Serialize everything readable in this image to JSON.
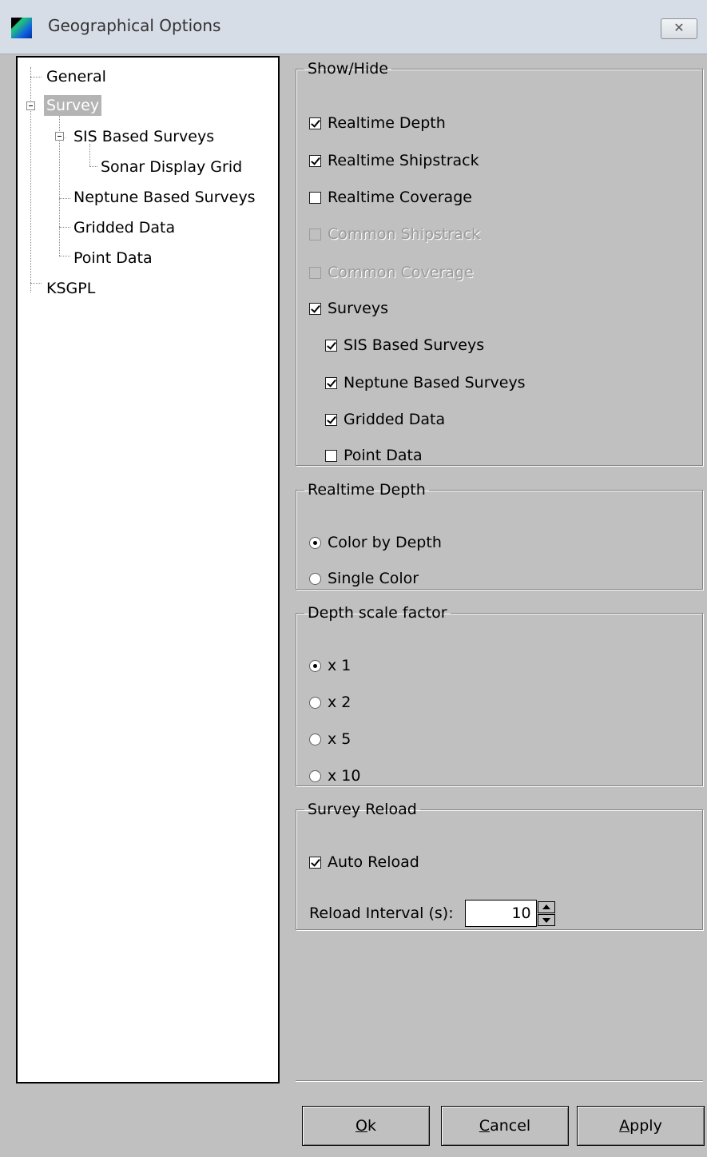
{
  "window": {
    "title": "Geographical Options",
    "close_glyph": "✕"
  },
  "tree": {
    "items": [
      {
        "label": "General"
      },
      {
        "label": "Survey",
        "selected": true
      },
      {
        "label": "SIS Based Surveys"
      },
      {
        "label": "Sonar Display Grid"
      },
      {
        "label": "Neptune Based Surveys"
      },
      {
        "label": "Gridded Data"
      },
      {
        "label": "Point Data"
      },
      {
        "label": "KSGPL"
      }
    ]
  },
  "show_hide": {
    "legend": "Show/Hide",
    "options": [
      {
        "label": "Realtime Depth",
        "checked": true,
        "enabled": true
      },
      {
        "label": "Realtime Shipstrack",
        "checked": true,
        "enabled": true
      },
      {
        "label": "Realtime Coverage",
        "checked": false,
        "enabled": true
      },
      {
        "label": "Common Shipstrack",
        "checked": false,
        "enabled": false
      },
      {
        "label": "Common Coverage",
        "checked": false,
        "enabled": false
      },
      {
        "label": "Surveys",
        "checked": true,
        "enabled": true
      },
      {
        "label": "SIS Based Surveys",
        "checked": true,
        "enabled": true
      },
      {
        "label": "Neptune Based Surveys",
        "checked": true,
        "enabled": true
      },
      {
        "label": "Gridded Data",
        "checked": true,
        "enabled": true
      },
      {
        "label": "Point Data",
        "checked": false,
        "enabled": true
      }
    ]
  },
  "realtime_depth": {
    "legend": "Realtime Depth",
    "options": [
      {
        "label": "Color by Depth",
        "selected": true
      },
      {
        "label": "Single Color",
        "selected": false
      }
    ]
  },
  "depth_scale": {
    "legend": "Depth scale factor",
    "options": [
      {
        "label": "x 1",
        "selected": true
      },
      {
        "label": "x 2",
        "selected": false
      },
      {
        "label": "x 5",
        "selected": false
      },
      {
        "label": "x 10",
        "selected": false
      }
    ]
  },
  "survey_reload": {
    "legend": "Survey Reload",
    "auto_reload": {
      "label": "Auto Reload",
      "checked": true
    },
    "interval_label": "Reload Interval (s):",
    "interval_value": "10"
  },
  "buttons": {
    "ok": {
      "accel": "O",
      "rest": "k"
    },
    "cancel": {
      "accel": "C",
      "rest": "ancel"
    },
    "apply": {
      "accel": "A",
      "rest": "pply"
    }
  }
}
